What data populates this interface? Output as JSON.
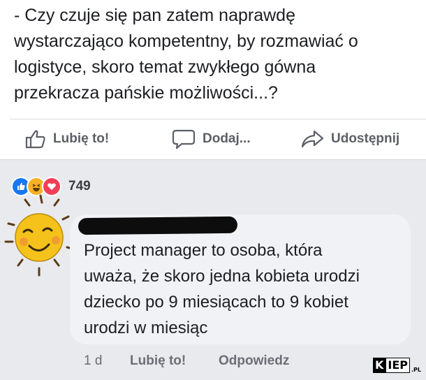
{
  "post": {
    "lines": [
      "- Czy czuje się pan zatem naprawdę",
      "wystarczająco kompetentny, by rozmawiać o",
      "logistyce, skoro temat zwykłego gówna",
      "przekracza pańskie możliwości...?"
    ],
    "actions": {
      "like_label": "Lubię to!",
      "comment_label": "Dodaj...",
      "share_label": "Udostępnij"
    }
  },
  "reactions": {
    "icons": [
      "like-reaction",
      "haha-reaction",
      "love-reaction"
    ],
    "count": "749"
  },
  "comment": {
    "avatar": "sun-sticker",
    "lines": [
      "Project manager to osoba, która",
      "uważa, że skoro jedna kobieta urodzi",
      "dziecko po 9 miesiącach to 9 kobiet",
      "urodzi w miesiąc"
    ],
    "meta": {
      "time": "1 d",
      "like_label": "Lubię to!",
      "reply_label": "Odpowiedz"
    }
  },
  "watermark": {
    "k": "K",
    "rest": "IEP",
    "suffix": ".PL"
  },
  "colors": {
    "like_blue": "#1877f2",
    "love_red": "#f33e58",
    "haha_yellow": "#f7b125",
    "sun_yellow": "#f5c21b"
  }
}
